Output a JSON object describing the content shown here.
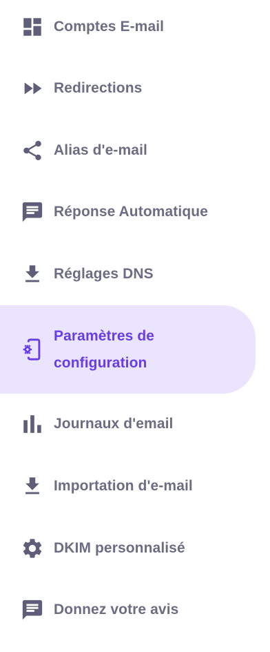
{
  "nav": {
    "items": [
      {
        "label": "Comptes E-mail",
        "icon": "dashboard-icon"
      },
      {
        "label": "Redirections",
        "icon": "fast-forward-icon"
      },
      {
        "label": "Alias d'e-mail",
        "icon": "share-icon"
      },
      {
        "label": "Réponse Automatique",
        "icon": "chat-icon"
      },
      {
        "label": "Réglages DNS",
        "icon": "download-icon"
      },
      {
        "label": "Paramètres de configuration",
        "icon": "phone-settings-icon",
        "active": true
      },
      {
        "label": "Journaux d'email",
        "icon": "bar-chart-icon"
      },
      {
        "label": "Importation d'e-mail",
        "icon": "download-icon"
      },
      {
        "label": "DKIM personnalisé",
        "icon": "gear-icon"
      },
      {
        "label": "Donnez votre avis",
        "icon": "chat-icon"
      }
    ]
  },
  "colors": {
    "text": "#6d6c83",
    "icon": "#5f5e79",
    "active_text": "#673de6",
    "active_bg": "#ebe4ff"
  }
}
